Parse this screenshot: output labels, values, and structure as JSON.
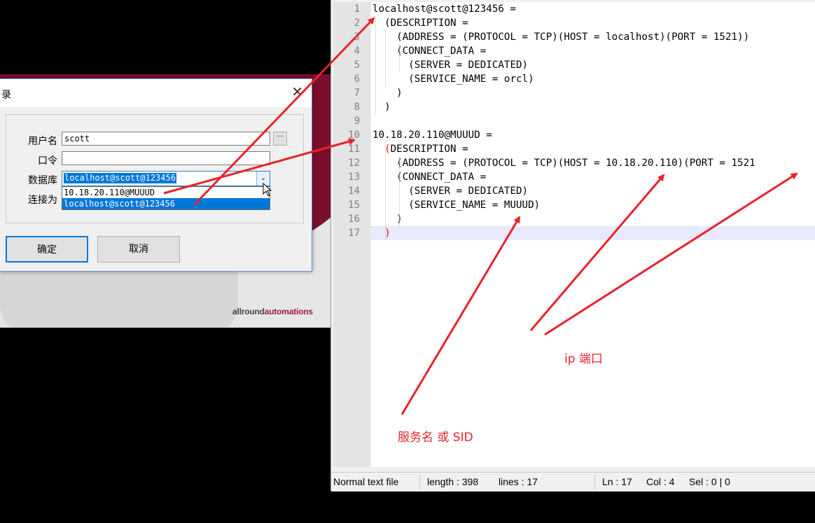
{
  "dialog": {
    "title": "录",
    "close_glyph": "✕",
    "username_label": "用户名",
    "username_value": "scott",
    "ellipsis_label": "···",
    "password_label": "口令",
    "password_value": "",
    "database_label": "数据库",
    "database_value": "localhost@scott@123456",
    "connect_as_label": "连接为",
    "dropdown_options": [
      "10.18.20.110@MUUUD",
      "localhost@scott@123456"
    ],
    "ok_label": "确定",
    "cancel_label": "取消"
  },
  "logo": {
    "text_plain": "allround",
    "text_accent": "automations"
  },
  "editor": {
    "lines": [
      {
        "n": "1",
        "text": "localhost@scott@123456 ="
      },
      {
        "n": "2",
        "text": "  (DESCRIPTION ="
      },
      {
        "n": "3",
        "text": "    (ADDRESS = (PROTOCOL = TCP)(HOST = localhost)(PORT = 1521))"
      },
      {
        "n": "4",
        "text": "    (CONNECT_DATA ="
      },
      {
        "n": "5",
        "text": "      (SERVER = DEDICATED)"
      },
      {
        "n": "6",
        "text": "      (SERVICE_NAME = orcl)"
      },
      {
        "n": "7",
        "text": "    )"
      },
      {
        "n": "8",
        "text": "  )"
      },
      {
        "n": "9",
        "text": ""
      },
      {
        "n": "10",
        "text": "10.18.20.110@MUUUD ="
      },
      {
        "n": "11",
        "text": "  (DESCRIPTION =",
        "paren": "("
      },
      {
        "n": "12",
        "text": "    (ADDRESS = (PROTOCOL = TCP)(HOST = 10.18.20.110)(PORT = 1521"
      },
      {
        "n": "13",
        "text": "    (CONNECT_DATA ="
      },
      {
        "n": "14",
        "text": "      (SERVER = DEDICATED)"
      },
      {
        "n": "15",
        "text": "      (SERVICE_NAME = MUUUD)"
      },
      {
        "n": "16",
        "text": "    )"
      },
      {
        "n": "17",
        "text": "  )",
        "paren": ")"
      }
    ]
  },
  "status": {
    "mode": "Normal text file",
    "length": "length : 398",
    "lines": "lines : 17",
    "ln": "Ln : 17",
    "col": "Col : 4",
    "sel": "Sel : 0 | 0"
  },
  "annotations": {
    "ip_port": "ip 端口",
    "service_name": "服务名 或 SID",
    "color": "#e8232a"
  }
}
